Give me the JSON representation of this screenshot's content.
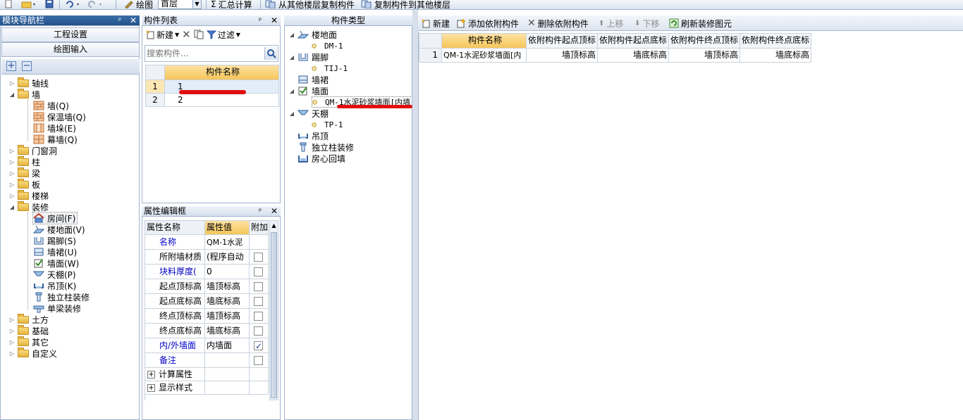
{
  "toolbar": {
    "draw_label": "绘图",
    "floor_value": "首层",
    "summary_label": "汇总计算",
    "copy_from_label": "从其他楼层复制构件",
    "copy_to_label": "复制构件到其他楼层"
  },
  "nav": {
    "title": "模块导航栏",
    "btn_project": "工程设置",
    "btn_draw": "绘图输入",
    "tree": {
      "axis": "轴线",
      "wall": "墙",
      "wall_children": [
        "墙(Q)",
        "保温墙(Q)",
        "墙垛(E)",
        "幕墙(Q)"
      ],
      "doorwin": "门窗洞",
      "column": "柱",
      "beam": "梁",
      "slab": "板",
      "stair": "楼梯",
      "decor": "装修",
      "decor_children": [
        "房间(F)",
        "楼地面(V)",
        "踢脚(S)",
        "墙裙(U)",
        "墙面(W)",
        "天棚(P)",
        "吊顶(K)",
        "独立柱装修",
        "单梁装修"
      ],
      "earth": "土方",
      "foundation": "基础",
      "other": "其它",
      "custom": "自定义"
    }
  },
  "component_list": {
    "title": "构件列表",
    "new_label": "新建",
    "filter_label": "过滤",
    "search_placeholder": "搜索构件...",
    "col_header": "构件名称",
    "rows": [
      {
        "num": "1",
        "name": "1"
      },
      {
        "num": "2",
        "name": "2"
      }
    ]
  },
  "prop_editor": {
    "title": "属性编辑框",
    "col_name": "属性名称",
    "col_value": "属性值",
    "col_extra": "附加",
    "rows": [
      {
        "name": "名称",
        "value": "QM-1水泥",
        "blue": true,
        "check": null
      },
      {
        "name": "所附墙材质",
        "value": "(程序自动",
        "blue": false,
        "check": false
      },
      {
        "name": "块料厚度(",
        "value": "0",
        "blue": true,
        "check": false
      },
      {
        "name": "起点顶标高",
        "value": "墙顶标高",
        "blue": false,
        "check": false
      },
      {
        "name": "起点底标高",
        "value": "墙底标高",
        "blue": false,
        "check": false
      },
      {
        "name": "终点顶标高",
        "value": "墙顶标高",
        "blue": false,
        "check": false
      },
      {
        "name": "终点底标高",
        "value": "墙底标高",
        "blue": false,
        "check": false
      },
      {
        "name": "内/外墙面",
        "value": "内墙面",
        "blue": true,
        "check": true
      },
      {
        "name": "备注",
        "value": "",
        "blue": true,
        "check": false
      }
    ],
    "groups": [
      "计算属性",
      "显示样式"
    ]
  },
  "component_type": {
    "title": "构件类型",
    "items": [
      {
        "label": "楼地面",
        "child": "DM-1"
      },
      {
        "label": "踢脚",
        "child": "TIJ-1"
      },
      {
        "label": "墙裙",
        "child": null
      },
      {
        "label": "墙面",
        "child": "QM-1水泥砂浆墙面[内墙"
      },
      {
        "label": "天棚",
        "child": "TP-1"
      },
      {
        "label": "吊顶",
        "child": null
      },
      {
        "label": "独立柱装修",
        "child": null
      },
      {
        "label": "房心回填",
        "child": null
      }
    ]
  },
  "right_panel": {
    "new_label": "新建",
    "add_dep_label": "添加依附构件",
    "del_dep_label": "删除依附构件",
    "up_label": "上移",
    "down_label": "下移",
    "refresh_label": "刷新装修图元",
    "headers": [
      "构件名称",
      "依附构件起点顶标",
      "依附构件起点底标",
      "依附构件终点顶标",
      "依附构件终点底标"
    ],
    "row": {
      "num": "1",
      "cells": [
        "QM-1水泥砂浆墙面[内",
        "墙顶标高",
        "墙底标高",
        "墙顶标高",
        "墙底标高"
      ]
    }
  }
}
